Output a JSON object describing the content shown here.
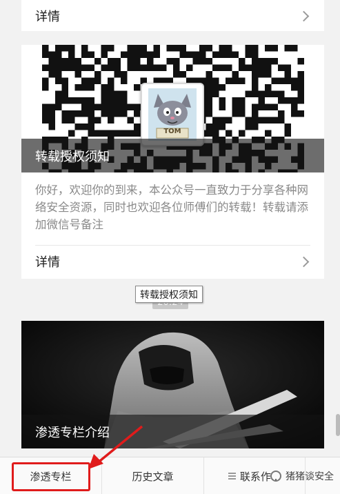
{
  "article_cards": [
    {
      "detail_label": "详情"
    },
    {
      "caption": "转载授权须知",
      "summary": "你好，欢迎你的到来，本公众号一直致力于分享各种网络安全资源，同时也欢迎各位师傅们的转载！转载请添加微信号备注",
      "detail_label": "详情",
      "avatar_text": "TOM"
    },
    {
      "caption": "渗透专栏介绍"
    }
  ],
  "tooltip": {
    "text": "转载授权须知"
  },
  "time_label": "20:24",
  "bottom_menu": {
    "tabs": [
      {
        "label": "渗透专栏"
      },
      {
        "label": "历史文章"
      },
      {
        "label": "联系作..."
      }
    ]
  },
  "watermark": {
    "text": "猪猪谈安全"
  },
  "colors": {
    "highlight": "#e01b1b",
    "caption_overlay": "#141414"
  }
}
